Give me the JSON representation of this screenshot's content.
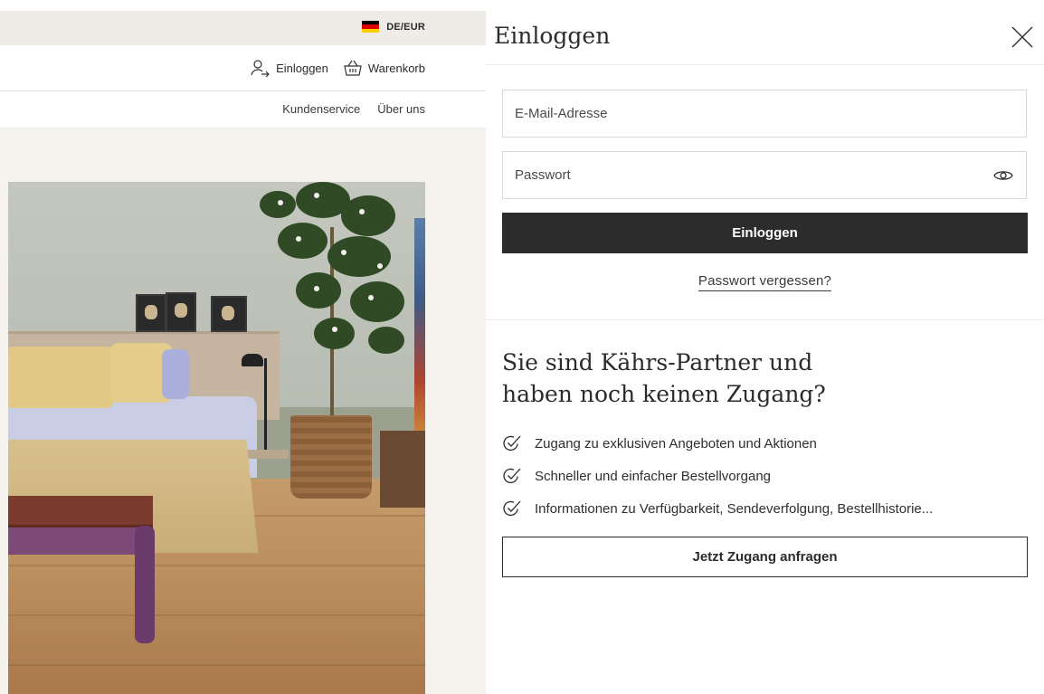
{
  "topbar": {
    "locale_label": "DE/EUR",
    "flag_colors": [
      "#000000",
      "#dd0000",
      "#ffce00"
    ]
  },
  "header": {
    "login_label": "Einloggen",
    "cart_label": "Warenkorb",
    "login_icon": "user-arrow-icon",
    "cart_icon": "basket-icon"
  },
  "subnav": {
    "items": [
      {
        "label": "Kundenservice"
      },
      {
        "label": "Über uns"
      }
    ]
  },
  "login_panel": {
    "title": "Einloggen",
    "close_icon": "close-icon",
    "email_placeholder": "E-Mail-Adresse",
    "password_placeholder": "Passwort",
    "password_toggle_icon": "eye-icon",
    "submit_label": "Einloggen",
    "forgot_label": "Passwort vergessen?"
  },
  "partner": {
    "heading_line1": "Sie sind Kährs-Partner und",
    "heading_line2": "haben noch keinen Zugang?",
    "check_icon": "check-circle-icon",
    "benefits": [
      {
        "text": "Zugang zu exklusiven Angeboten und Aktionen"
      },
      {
        "text": "Schneller und einfacher Bestellvorgang"
      },
      {
        "text": "Informationen zu Verfügbarkeit, Sendeverfolgung, Bestellhistorie..."
      }
    ],
    "request_label": "Jetzt Zugang anfragen"
  },
  "colors": {
    "topbar_bg": "#efebe6",
    "page_bg": "#f6f2ee",
    "primary_button": "#2c2c2c",
    "text": "#2b2b2b"
  }
}
